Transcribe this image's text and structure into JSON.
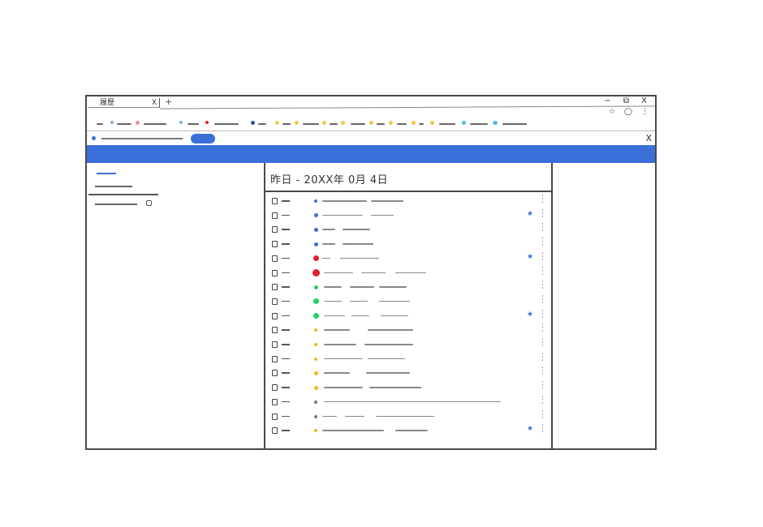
{
  "tab": {
    "title": "履歷",
    "close": "X",
    "new": "+"
  },
  "window_controls": "− ⧉ X",
  "address_icons": "☆ ◯ ⋮",
  "search": {
    "close": "X"
  },
  "main": {
    "date_heading": "昨日 - 20XX年 0月 4日",
    "rows": [
      {
        "dot": "#3a6fd8",
        "size": 4,
        "starred": false
      },
      {
        "dot": "#3a6fd8",
        "size": 5,
        "starred": true
      },
      {
        "dot": "#3a6fd8",
        "size": 5,
        "starred": false
      },
      {
        "dot": "#3a6fd8",
        "size": 5,
        "starred": false
      },
      {
        "dot": "#e0202e",
        "size": 7,
        "starred": true
      },
      {
        "dot": "#e0202e",
        "size": 9,
        "starred": false
      },
      {
        "dot": "#1fd460",
        "size": 5,
        "starred": false
      },
      {
        "dot": "#1fd460",
        "size": 7,
        "starred": false
      },
      {
        "dot": "#1fd460",
        "size": 7,
        "starred": true
      },
      {
        "dot": "#f2b620",
        "size": 4,
        "starred": false
      },
      {
        "dot": "#f2b620",
        "size": 4,
        "starred": false
      },
      {
        "dot": "#f2b620",
        "size": 4,
        "starred": false
      },
      {
        "dot": "#f2b620",
        "size": 5,
        "starred": false
      },
      {
        "dot": "#f2b620",
        "size": 5,
        "starred": false
      },
      {
        "dot": "#777777",
        "size": 4,
        "starred": false
      },
      {
        "dot": "#777777",
        "size": 4,
        "starred": false
      },
      {
        "dot": "#f2b620",
        "size": 4,
        "starred": true
      }
    ]
  },
  "colors": {
    "accent": "#3a6fd8",
    "frame": "#4a4a4a"
  }
}
